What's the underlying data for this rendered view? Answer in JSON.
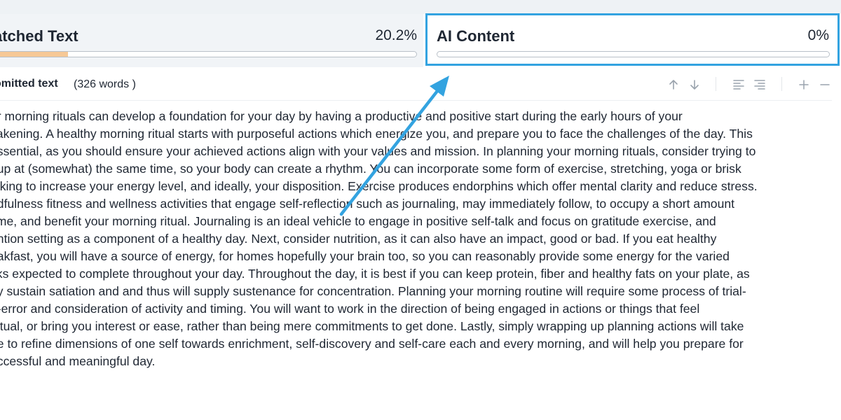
{
  "matched_card": {
    "title": "atched Text",
    "percent_label": "20.2%",
    "progress": 0.17,
    "fill_color": "#f6c896"
  },
  "ai_card": {
    "title": "AI Content",
    "percent_label": "0%",
    "progress": 0,
    "highlight_color": "#33a3e0"
  },
  "toolbar": {
    "label": "omitted text",
    "word_count": "(326 words )",
    "icons": [
      "arrow-up-icon",
      "arrow-down-icon",
      "align-left-icon",
      "align-right-icon",
      "plus-icon",
      "minus-icon"
    ]
  },
  "body": {
    "lines": [
      "ur morning rituals can develop a foundation for your day by having a productive and positive start during the early hours of your",
      "vakening. A healthy morning ritual starts with purposeful actions which energize you, and prepare you to face the challenges of the day. This",
      "essential, as you should ensure your achieved actions align with your values and mission. In planning your morning rituals, consider trying to",
      "t up at (somewhat) the same time, so your body can create a rhythm. You can incorporate some form of exercise, stretching, yoga or brisk",
      "alking to increase your energy level, and ideally, your disposition. Exercise produces endorphins which offer mental clarity and reduce stress.",
      "ndfulness fitness and wellness activities that engage self-reflection such as journaling, may immediately follow, to occupy a short amount",
      "time, and benefit your morning ritual. Journaling is an ideal vehicle to engage in positive self-talk and focus on gratitude exercise, and",
      "ention setting as a component of a healthy day. Next, consider nutrition, as it can also have an impact, good or bad. If you eat healthy",
      "eakfast, you will have a source of energy, for homes hopefully your brain too, so you can reasonably provide some energy for the varied",
      "sks expected to complete throughout your day. Throughout the day, it is best if you can keep protein, fiber and healthy fats on your plate, as",
      "ey sustain satiation and and thus will supply sustenance for concentration. Planning your morning routine will require some process of trial-",
      "d-error and consideration of activity and timing. You will want to work in the direction of being engaged in actions or things that feel",
      "bitual, or bring you interest or ease, rather than being mere commitments to get done. Lastly, simply wrapping up planning actions will take",
      "ne to refine dimensions of one self towards enrichment, self-discovery and self-care each and every morning, and will help you prepare for",
      "uccessful and meaningful day."
    ]
  },
  "annotation_arrow_color": "#33a3e0"
}
